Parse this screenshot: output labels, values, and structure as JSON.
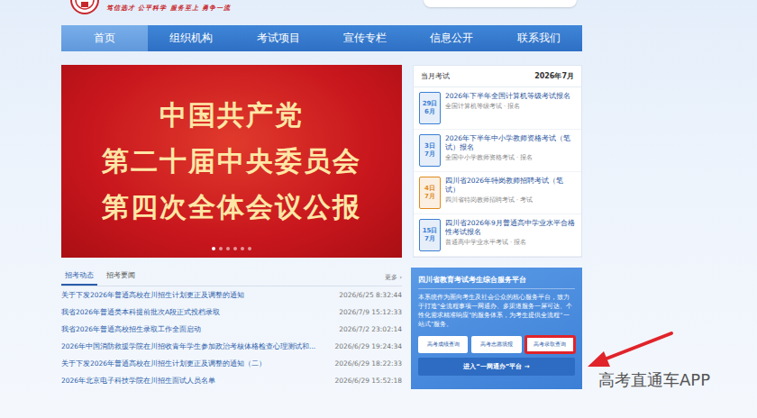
{
  "header": {
    "slogan": "笃信选才 公平科学 服务至上 勇争一流"
  },
  "nav": [
    {
      "label": "首页",
      "selected": true
    },
    {
      "label": "组织机构",
      "selected": false
    },
    {
      "label": "考试项目",
      "selected": false
    },
    {
      "label": "宣传专栏",
      "selected": false
    },
    {
      "label": "信息公开",
      "selected": false
    },
    {
      "label": "联系我们",
      "selected": false
    }
  ],
  "banner": {
    "lines": [
      "中国共产党",
      "第二十届中央委员会",
      "第四次全体会议公报"
    ],
    "dots": [
      {
        "selected": true
      },
      {
        "selected": false
      },
      {
        "selected": false
      },
      {
        "selected": false
      },
      {
        "selected": false
      },
      {
        "selected": false
      }
    ]
  },
  "exams": {
    "title": "当月考试",
    "month": "2026年7月",
    "items": [
      {
        "day": "29日",
        "month": "6月",
        "title": "2026年下半年全国计算机等级考试报名",
        "meta": "全国计算机等级考试 · 报名",
        "color": "#3b7fd4"
      },
      {
        "day": "3日",
        "month": "7月",
        "title": "2026年下半年中小学教师资格考试（笔试）报名",
        "meta": "全国中小学教师资格考试 · 报名",
        "color": "#3b7fd4"
      },
      {
        "day": "4日",
        "month": "7月",
        "title": "四川省2026年特岗教师招聘考试（笔试）",
        "meta": "四川省特岗教师招聘考试 · 考试",
        "color": "#e08a1e"
      },
      {
        "day": "15日",
        "month": "7月",
        "title": "四川省2026年9月普通高中学业水平合格性考试报名",
        "meta": "普通高中学业水平考试 · 报名",
        "color": "#3b7fd4"
      }
    ]
  },
  "news": {
    "tabs": [
      {
        "label": "招考动态",
        "selected": true
      },
      {
        "label": "招考要闻",
        "selected": false
      }
    ],
    "more": "更多 ›",
    "rows": [
      {
        "title": "关于下发2026年普通高校在川招生计划更正及调整的通知",
        "time": "2026/6/25 8:32:44"
      },
      {
        "title": "我省2026年普通类本科提前批次A段正式投档录取",
        "time": "2026/7/9 15:12:33"
      },
      {
        "title": "我省2026年普通高校招生录取工作全面启动",
        "time": "2026/7/2 23:02:14"
      },
      {
        "title": "2026年中国消防救援学院在川招收青年学生参加政治考核体格检查心理测试和...",
        "time": "2026/6/29 19:24:34"
      },
      {
        "title": "关于下发2026年普通高校在川招生计划更正及调整的通知（二）",
        "time": "2026/6/29 18:22:33"
      },
      {
        "title": "2026年北京电子科技学院在川招生面试人员名单",
        "time": "2026/6/29 15:52:18"
      }
    ]
  },
  "platform": {
    "title": "四川省教育考试考生综合服务平台",
    "description": "本系统作为面向考生及社会公众的核心服务平台，致力于打造“全流程事项一网通办、多渠道服务一屏可达、个性化需求精准响应”的服务体系，为考生提供全流程“一站式”服务。",
    "buttons": [
      {
        "label": "高考成绩查询",
        "annotated": false
      },
      {
        "label": "高考志愿填报",
        "annotated": false
      },
      {
        "label": "高考录取查询",
        "annotated": true
      }
    ],
    "enter": "进入“一网通办”平台 →"
  },
  "annotation": {
    "watermark": "高考直通车APP"
  }
}
